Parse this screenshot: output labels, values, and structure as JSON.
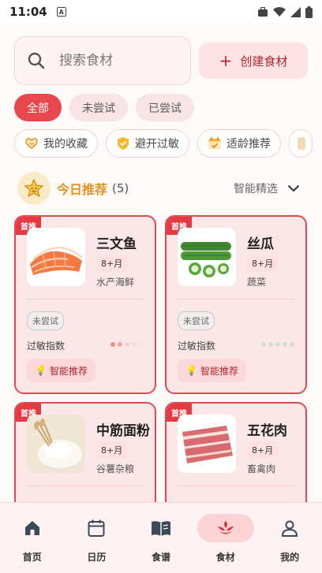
{
  "status": {
    "time": "11:04"
  },
  "search": {
    "placeholder": "搜索食材"
  },
  "create": {
    "label": "创建食材"
  },
  "tabs": [
    {
      "label": "全部",
      "active": true
    },
    {
      "label": "未尝试",
      "active": false
    },
    {
      "label": "已尝试",
      "active": false
    }
  ],
  "chips": [
    {
      "label": "我的收藏",
      "icon": "heart-icon"
    },
    {
      "label": "避开过敏",
      "icon": "shield-icon"
    },
    {
      "label": "适龄推荐",
      "icon": "calendar-icon"
    }
  ],
  "recommend": {
    "title": "今日推荐",
    "count": "(5)",
    "smart_label": "智能精选"
  },
  "cards": [
    {
      "badge": "首推",
      "name": "三文鱼",
      "age": "8+月",
      "category": "水产海鲜",
      "status": "未尝试",
      "allergy_label": "过敏指数",
      "allergy_level": 2,
      "smart_label": "智能推荐",
      "image": "salmon"
    },
    {
      "badge": "首推",
      "name": "丝瓜",
      "age": "8+月",
      "category": "蔬菜",
      "status": "未尝试",
      "allergy_label": "过敏指数",
      "allergy_level": 0,
      "smart_label": "智能推荐",
      "image": "okra"
    },
    {
      "badge": "首推",
      "name": "中筋面粉",
      "age": "8+月",
      "category": "谷薯杂粮",
      "status": "",
      "allergy_label": "",
      "allergy_level": null,
      "smart_label": "",
      "image": "flour"
    },
    {
      "badge": "首推",
      "name": "五花肉",
      "age": "8+月",
      "category": "畜禽肉",
      "status": "",
      "allergy_label": "",
      "allergy_level": null,
      "smart_label": "",
      "image": "pork"
    }
  ],
  "nav": [
    {
      "label": "首页",
      "icon": "home-icon",
      "active": false
    },
    {
      "label": "日历",
      "icon": "calendar-icon",
      "active": false
    },
    {
      "label": "食谱",
      "icon": "book-icon",
      "active": false
    },
    {
      "label": "食材",
      "icon": "ingredient-icon",
      "active": true
    },
    {
      "label": "我的",
      "icon": "profile-icon",
      "active": false
    }
  ],
  "colors": {
    "accent": "#e8474e",
    "gold": "#e2931a",
    "card_bg": "#fbe7e7"
  }
}
